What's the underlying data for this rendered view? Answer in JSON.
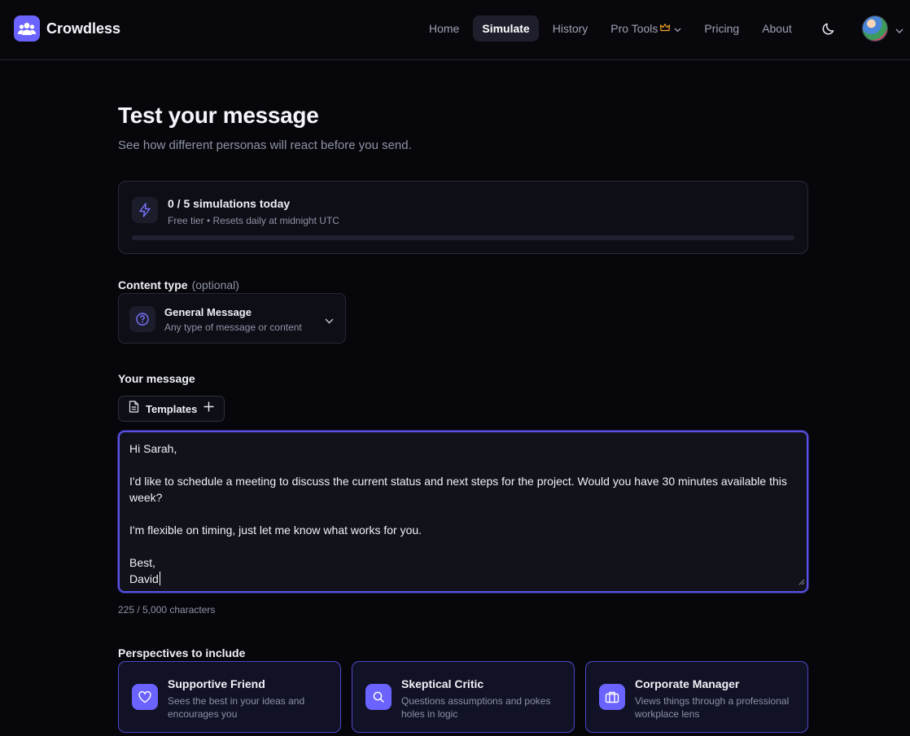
{
  "app": {
    "name": "Crowdless",
    "logo_icon": "users-group-icon",
    "accent_color": "#6b63ff"
  },
  "nav": {
    "items": [
      {
        "label": "Home",
        "active": false
      },
      {
        "label": "Simulate",
        "active": true
      },
      {
        "label": "History",
        "active": false
      },
      {
        "label": "Pro Tools",
        "active": false,
        "badge_icon": "crown-icon",
        "has_dropdown": true
      },
      {
        "label": "Pricing",
        "active": false
      },
      {
        "label": "About",
        "active": false
      }
    ],
    "theme_toggle_icon": "moon-icon",
    "user_menu_icon": "chevron-down-icon"
  },
  "page": {
    "title": "Test your message",
    "subtitle": "See how different personas will react before you send."
  },
  "usage": {
    "title": "0 / 5 simulations today",
    "subtitle": "Free tier • Resets daily at midnight UTC",
    "used": 0,
    "limit": 5,
    "icon": "lightning-icon"
  },
  "content_type": {
    "label": "Content type",
    "optional_label": "(optional)",
    "selected_title": "General Message",
    "selected_description": "Any type of message or content",
    "icon": "question-circle-icon"
  },
  "message": {
    "label": "Your message",
    "templates_label": "Templates",
    "lines": [
      "Hi Sarah,",
      "",
      "I'd like to schedule a meeting to discuss the current status and next steps for the project. Would you have 30 minutes available this",
      "week?",
      "",
      "I'm flexible on timing, just let me know what works for you.",
      "",
      "Best,",
      "David"
    ],
    "char_count": "225 / 5,000 characters"
  },
  "perspectives": {
    "label": "Perspectives to include",
    "items": [
      {
        "title": "Supportive Friend",
        "description": "Sees the best in your ideas and encourages you",
        "icon": "heart-icon"
      },
      {
        "title": "Skeptical Critic",
        "description": "Questions assumptions and pokes holes in logic",
        "icon": "search-icon"
      },
      {
        "title": "Corporate Manager",
        "description": "Views things through a professional workplace lens",
        "icon": "briefcase-icon"
      }
    ]
  }
}
